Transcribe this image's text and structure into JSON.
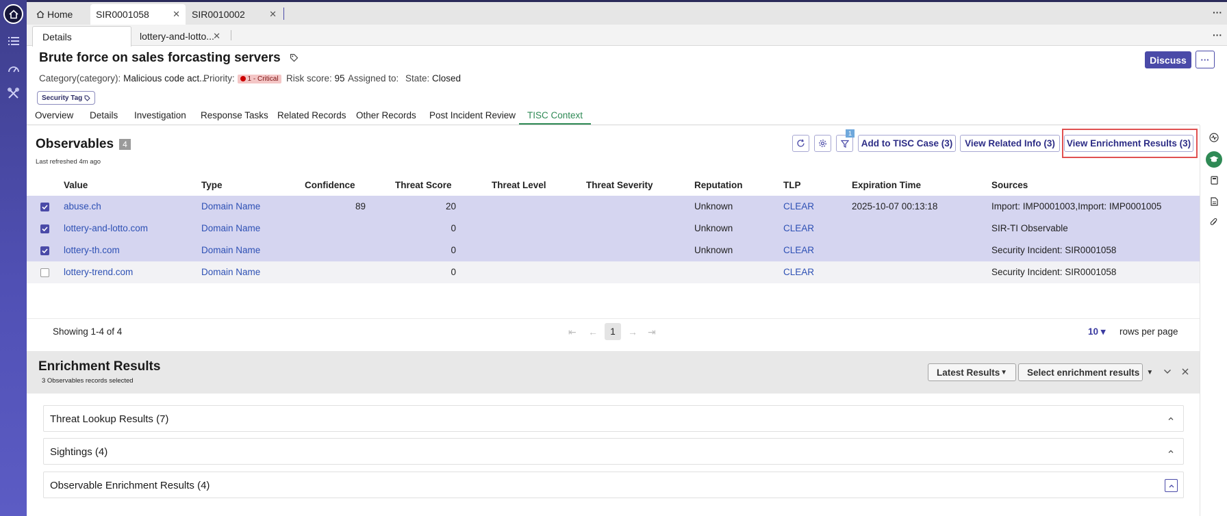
{
  "top_tabs": [
    {
      "label": "Home"
    },
    {
      "label": "SIR0001058"
    },
    {
      "label": "SIR0010002"
    }
  ],
  "sub_tabs": [
    {
      "label": "Details"
    },
    {
      "label": "lottery-and-lotto..."
    }
  ],
  "record": {
    "title": "Brute force on sales forcasting servers",
    "category_label": "Category(category):",
    "category_value": "Malicious code act...",
    "priority_label": "Priority:",
    "priority_value": "1 - Critical",
    "risk_label": "Risk score:",
    "risk_value": "95",
    "assigned_label": "Assigned to:",
    "assigned_value": "",
    "state_label": "State:",
    "state_value": "Closed",
    "tag": "Security Tag",
    "discuss_label": "Discuss"
  },
  "section_tabs": [
    {
      "label": "Overview"
    },
    {
      "label": "Details"
    },
    {
      "label": "Investigation"
    },
    {
      "label": "Response Tasks"
    },
    {
      "label": "Related Records"
    },
    {
      "label": "Other Records"
    },
    {
      "label": "Post Incident Review"
    },
    {
      "label": "TISC Context"
    }
  ],
  "observables": {
    "title": "Observables",
    "count": "4",
    "last_refreshed": "Last refreshed 4m ago",
    "filter_badge": "1",
    "btn_add": "Add to TISC Case (3)",
    "btn_related": "View Related Info (3)",
    "btn_enrich": "View Enrichment Results (3)",
    "columns": [
      "Value",
      "Type",
      "Confidence",
      "Threat Score",
      "Threat Level",
      "Threat Severity",
      "Reputation",
      "TLP",
      "Expiration Time",
      "Sources"
    ],
    "rows": [
      {
        "checked": true,
        "value": "abuse.ch",
        "type": "Domain Name",
        "confidence": "89",
        "threat_score": "20",
        "threat_level": "",
        "threat_severity": "",
        "reputation": "Unknown",
        "tlp": "CLEAR",
        "expiration": "2025-10-07 00:13:18",
        "sources": "Import: IMP0001003,Import: IMP0001005"
      },
      {
        "checked": true,
        "value": "lottery-and-lotto.com",
        "type": "Domain Name",
        "confidence": "",
        "threat_score": "0",
        "threat_level": "",
        "threat_severity": "",
        "reputation": "Unknown",
        "tlp": "CLEAR",
        "expiration": "",
        "sources": "SIR-TI Observable"
      },
      {
        "checked": true,
        "value": "lottery-th.com",
        "type": "Domain Name",
        "confidence": "",
        "threat_score": "0",
        "threat_level": "",
        "threat_severity": "",
        "reputation": "Unknown",
        "tlp": "CLEAR",
        "expiration": "",
        "sources": "Security Incident: SIR0001058"
      },
      {
        "checked": false,
        "value": "lottery-trend.com",
        "type": "Domain Name",
        "confidence": "",
        "threat_score": "0",
        "threat_level": "",
        "threat_severity": "",
        "reputation": "",
        "tlp": "CLEAR",
        "expiration": "",
        "sources": "Security Incident: SIR0001058"
      }
    ],
    "showing": "Showing 1-4 of 4",
    "page": "1",
    "rows_per_page": "10",
    "rows_per_page_label": "rows per page"
  },
  "enrichment": {
    "title": "Enrichment Results",
    "subtitle": "3 Observables records selected",
    "dd_latest": "Latest Results",
    "dd_select": "Select enrichment results",
    "sections": [
      {
        "label": "Threat Lookup Results (7)"
      },
      {
        "label": "Sightings (4)"
      },
      {
        "label": "Observable Enrichment Results (4)"
      }
    ]
  },
  "icons": {
    "home": "home-icon",
    "list": "list-icon",
    "gauge": "gauge-icon",
    "tools": "tools-icon",
    "tag": "tag-icon",
    "refresh": "refresh-icon",
    "gear": "gear-icon",
    "filter": "filter-icon"
  },
  "colors": {
    "accent": "#4a4aa8",
    "active_tab": "#2f8a55",
    "selected_row": "#d5d5f0",
    "highlight": "#e05050"
  }
}
